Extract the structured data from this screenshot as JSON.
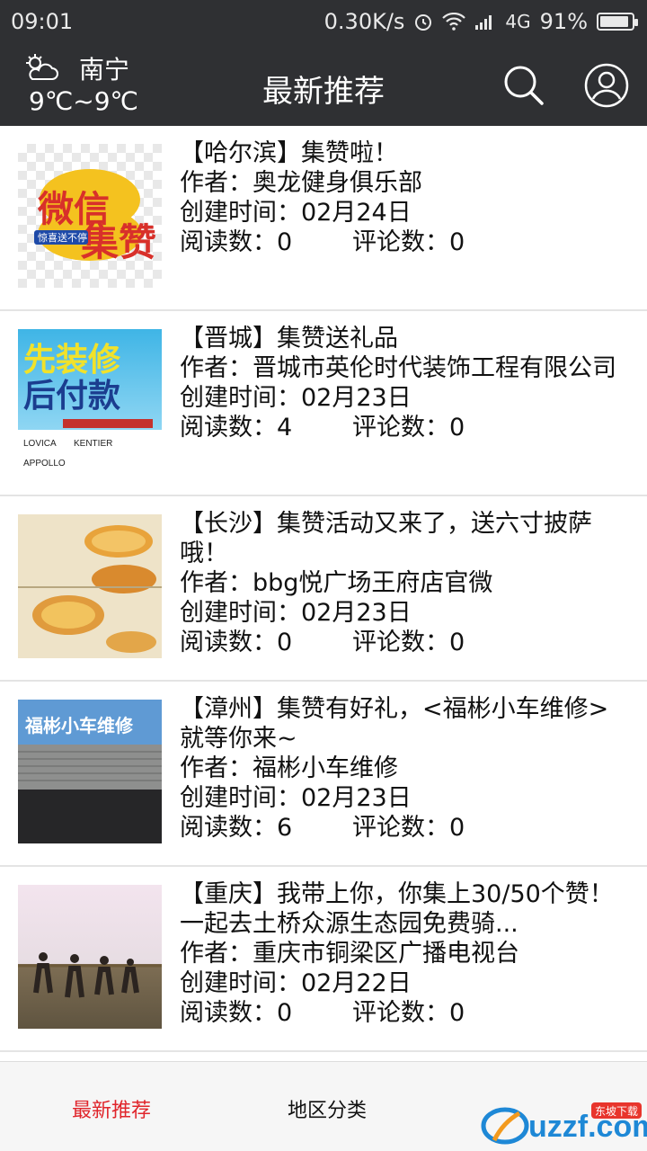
{
  "status": {
    "time": "09:01",
    "net_speed": "0.30K/s",
    "network": "4G",
    "battery": "91%",
    "battery_level": 0.91
  },
  "header": {
    "city": "南宁",
    "temp": "9℃~9℃",
    "title": "最新推荐",
    "weather_icon": "cloud-sun-icon",
    "search_icon": "search-icon",
    "user_icon": "user-icon"
  },
  "items": [
    {
      "title": "【哈尔滨】集赞啦！",
      "author": "作者：奥龙健身俱乐部",
      "created": "创建时间：02月24日",
      "reads": "阅读数：0",
      "comments": "评论数：0"
    },
    {
      "title": "【晋城】集赞送礼品",
      "author": "作者：晋城市英伦时代装饰工程有限公司",
      "created": "创建时间：02月23日",
      "reads": "阅读数：4",
      "comments": "评论数：0"
    },
    {
      "title": "【长沙】集赞活动又来了，送六寸披萨哦！",
      "author": "作者：bbg悦广场王府店官微",
      "created": "创建时间：02月23日",
      "reads": "阅读数：0",
      "comments": "评论数：0"
    },
    {
      "title": "【漳州】集赞有好礼，<福彬小车维修>就等你来~",
      "author": "作者：福彬小车维修",
      "created": "创建时间：02月23日",
      "reads": "阅读数：6",
      "comments": "评论数：0"
    },
    {
      "title": "【重庆】我带上你，你集上30/50个赞！一起去土桥众源生态园免费骑...",
      "author": "作者：重庆市铜梁区广播电视台",
      "created": "创建时间：02月22日",
      "reads": "阅读数：0",
      "comments": "评论数：0"
    }
  ],
  "thumbs": {
    "t1": {
      "line1": "微信",
      "line2": "集赞",
      "tag": "惊喜送不停"
    },
    "t2": {
      "line1": "先装修",
      "line2": "后付款",
      "brands": [
        "LOVICA",
        "KENTIER",
        "APPOLLO"
      ]
    },
    "t4": {
      "sign": "福彬小车维修"
    }
  },
  "tabs": [
    {
      "label": "最新推荐",
      "active": true
    },
    {
      "label": "地区分类",
      "active": false
    }
  ],
  "watermark": {
    "text": "uzzf.com",
    "badge": "东坡下载"
  },
  "colors": {
    "bar": "#2f3033",
    "active_tab": "#e0252b"
  }
}
